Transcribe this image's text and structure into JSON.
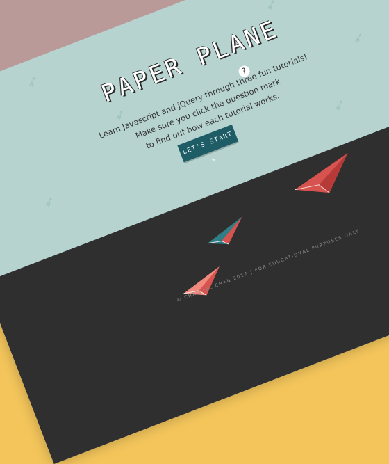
{
  "hero": {
    "title": "PAPER PLANE",
    "line1": "Learn Javascript and jQuery through three fun tutorials!",
    "line2": "Make sure you click the question mark",
    "line3": "to find out how each tutorial works.",
    "cta": "LET'S START >"
  },
  "footer": {
    "copyright": "© CHRISTEL CHAN 2017 | FOR EDUCATIONAL PURPOSES ONLY"
  },
  "colors": {
    "background": "#f3c55b",
    "top_bar": "#b99a98",
    "hero": "#b6d3d0",
    "footer": "#2f2f2f",
    "button": "#1f5d66",
    "plane_red": "#d6534f",
    "plane_teal": "#2f7e86"
  },
  "icons": {
    "help": "question-mark-icon",
    "plane": "paper-plane-icon"
  }
}
